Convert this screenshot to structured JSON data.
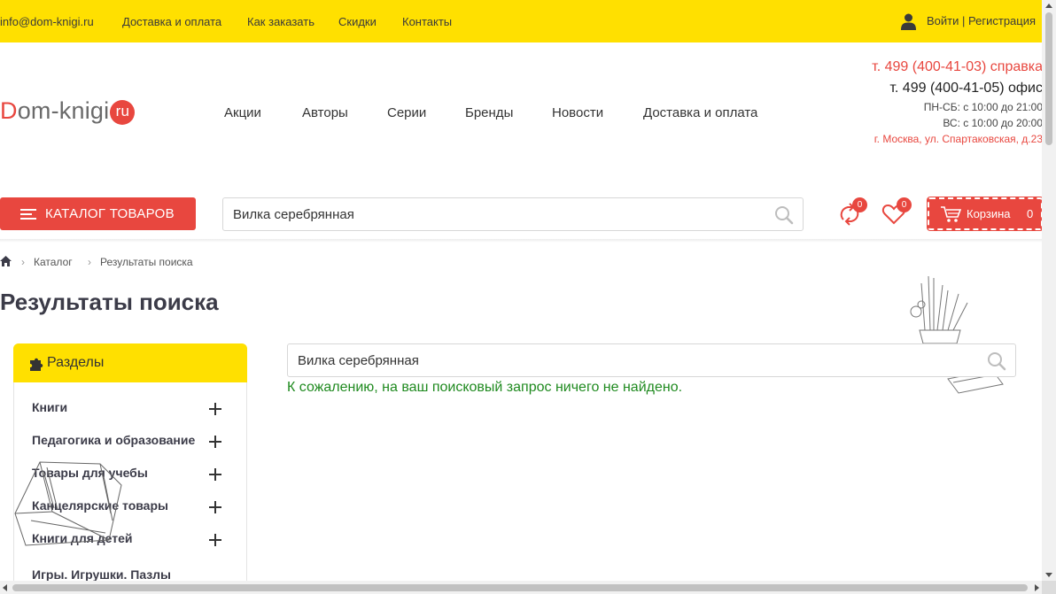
{
  "topbar": {
    "email": "info@dom-knigi.ru",
    "links": [
      "Доставка и оплата",
      "Как заказать",
      "Скидки",
      "Контакты"
    ],
    "login": "Войти",
    "divider": "|",
    "register": "Регистрация",
    "background": "#ffe000"
  },
  "header": {
    "logo_first": "D",
    "logo_rest": "om-knigi",
    "logo_badge": "ru",
    "nav": [
      "Акции",
      "Авторы",
      "Серии",
      "Бренды",
      "Новости",
      "Доставка и оплата"
    ],
    "phone_help": "т. 499 (400-41-03) справка",
    "phone_office": "т. 499 (400-41-05) офис",
    "hours_weekdays": "ПН-СБ: с 10:00 до 21:00",
    "hours_sunday": "ВС: с 10:00 до 20:00",
    "address": "г. Москва, ул. Спартаковская, д.23"
  },
  "toolbar": {
    "catalog_label": "КАТАЛОГ ТОВАРОВ",
    "search_value": "Вилка серебрянная",
    "compare_count": "0",
    "favorites_count": "0",
    "cart_label": "Корзина",
    "cart_count": "0",
    "accent": "#e8473f"
  },
  "breadcrumb": {
    "items": [
      "Каталог",
      "Результаты поиска"
    ],
    "separator": "›"
  },
  "page_title": "Результаты поиска",
  "sidebar": {
    "title": "Разделы",
    "items": [
      {
        "label": "Книги"
      },
      {
        "label": "Педагогика и образование"
      },
      {
        "label": "Товары для учебы"
      },
      {
        "label": "Канцелярские товары"
      },
      {
        "label": "Книги для детей"
      },
      {
        "label": "Игры. Игрушки. Пазлы"
      }
    ]
  },
  "main": {
    "search_value": "Вилка серебрянная",
    "not_found_message": "К сожалению, на ваш поисковый запрос ничего не найдено.",
    "message_color": "#1f8a1f"
  }
}
